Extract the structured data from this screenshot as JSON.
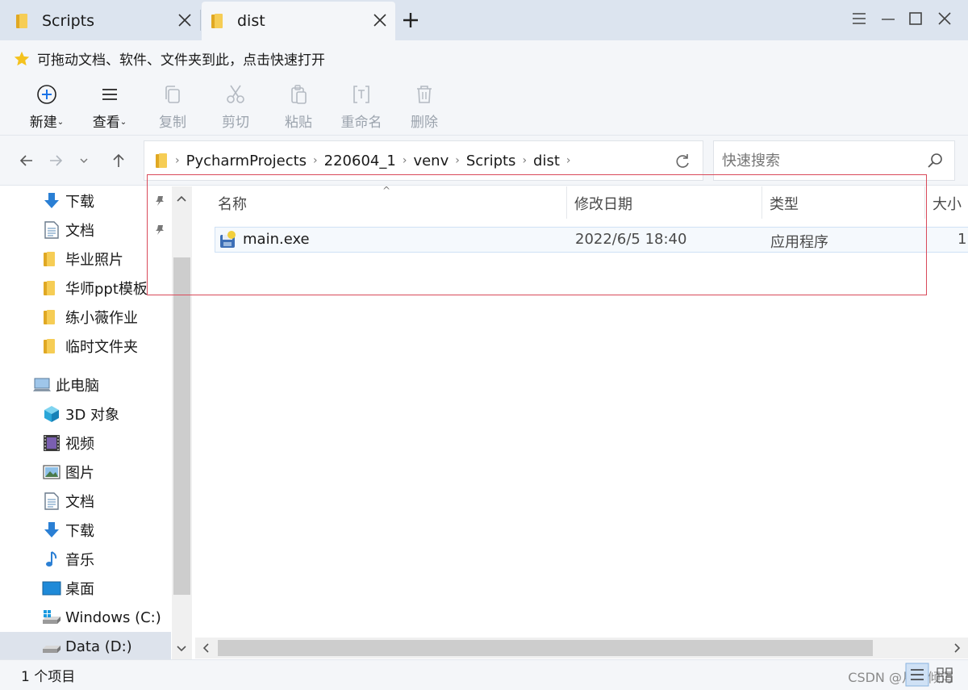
{
  "tabs": [
    {
      "label": "Scripts",
      "active": false
    },
    {
      "label": "dist",
      "active": true
    }
  ],
  "favorites_hint": "可拖动文档、软件、文件夹到此，点击快速打开",
  "toolbar": {
    "new_label": "新建",
    "view_label": "查看",
    "copy_label": "复制",
    "cut_label": "剪切",
    "paste_label": "粘贴",
    "rename_label": "重命名",
    "delete_label": "删除",
    "caret": "⌄"
  },
  "breadcrumb": [
    "PycharmProjects",
    "220604_1",
    "venv",
    "Scripts",
    "dist"
  ],
  "search": {
    "placeholder": "快速搜索"
  },
  "sidebar": {
    "quick_access": [
      {
        "label": "下载",
        "icon": "download-icon"
      },
      {
        "label": "文档",
        "icon": "document-icon"
      },
      {
        "label": "毕业照片",
        "icon": "folder-icon"
      },
      {
        "label": "华师ppt模板",
        "icon": "folder-icon"
      },
      {
        "label": "练小薇作业",
        "icon": "folder-icon"
      },
      {
        "label": "临时文件夹",
        "icon": "folder-icon"
      }
    ],
    "this_pc": "此电脑",
    "pc_items": [
      {
        "label": "3D 对象",
        "icon": "3d-objects-icon"
      },
      {
        "label": "视频",
        "icon": "video-icon"
      },
      {
        "label": "图片",
        "icon": "pictures-icon"
      },
      {
        "label": "文档",
        "icon": "document-icon"
      },
      {
        "label": "下载",
        "icon": "download-icon"
      },
      {
        "label": "音乐",
        "icon": "music-icon"
      },
      {
        "label": "桌面",
        "icon": "desktop-icon"
      },
      {
        "label": "Windows (C:)",
        "icon": "drive-c-icon"
      },
      {
        "label": "Data (D:)",
        "icon": "drive-d-icon"
      }
    ]
  },
  "columns": {
    "name": "名称",
    "date": "修改日期",
    "type": "类型",
    "size": "大小"
  },
  "files": [
    {
      "name": "main.exe",
      "date": "2022/6/5 18:40",
      "type": "应用程序",
      "size": "1"
    }
  ],
  "status": {
    "item_count": "1 个项目"
  },
  "watermark": "CSDN @月光倾泻",
  "colors": {
    "accent": "#1a73e8",
    "highlight_box": "#d94a5a",
    "folder": "#f6cd55"
  }
}
